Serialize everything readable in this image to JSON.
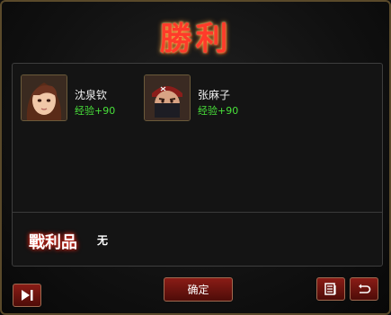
{
  "title": "勝利",
  "party": [
    {
      "name": "沈泉钦",
      "exp_label": "经验",
      "exp_value": "+90"
    },
    {
      "name": "张麻子",
      "exp_label": "经验",
      "exp_value": "+90"
    }
  ],
  "loot": {
    "label": "戰利品",
    "value": "无"
  },
  "buttons": {
    "confirm_label": "确定"
  },
  "icons": {
    "skip": "skip-forward-icon",
    "log": "document-list-icon",
    "replay": "replay-icon"
  },
  "colors": {
    "title": "#ff3b2a",
    "exp": "#48e03a",
    "button": "#8a1c16"
  }
}
